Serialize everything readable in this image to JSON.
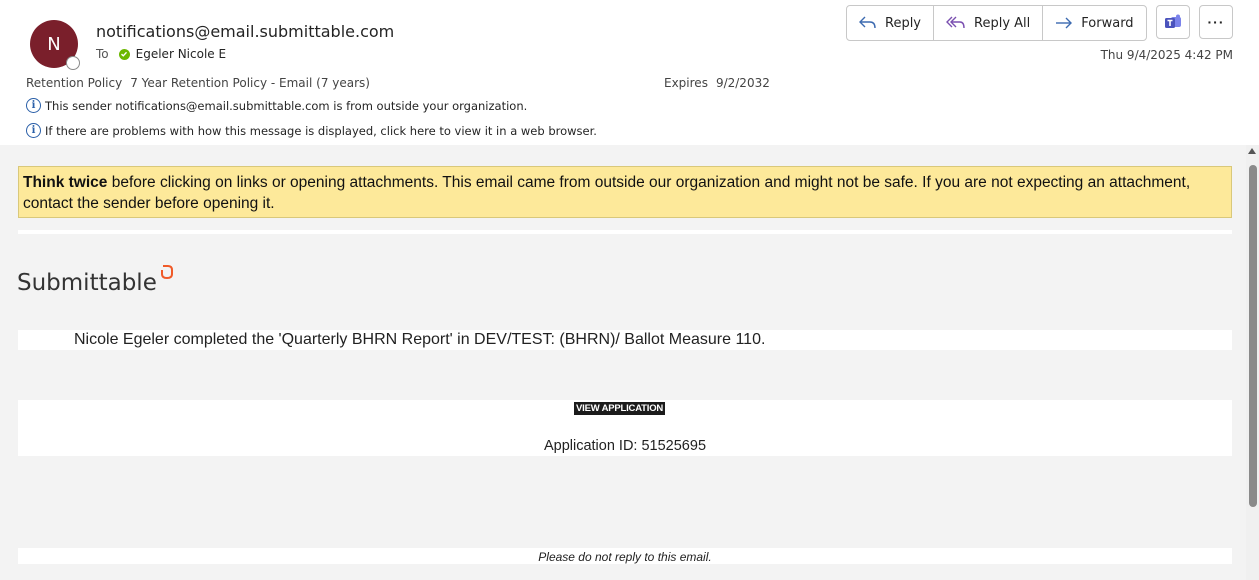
{
  "header": {
    "avatar_initial": "N",
    "sender": "notifications@email.submittable.com",
    "to_label": "To",
    "recipient": "Egeler Nicole E",
    "retention_label": "Retention Policy",
    "retention_value": "7 Year Retention Policy - Email (7 years)",
    "expires_label": "Expires",
    "expires_value": "9/2/2032",
    "info_external": "This sender notifications@email.submittable.com is from outside your organization.",
    "info_display": "If there are problems with how this message is displayed, click here to view it in a web browser.",
    "datetime": "Thu 9/4/2025 4:42 PM"
  },
  "actions": {
    "reply": "Reply",
    "reply_all": "Reply All",
    "forward": "Forward",
    "more": "···"
  },
  "body": {
    "warning_bold": "Think twice",
    "warning_text": " before clicking on links or opening attachments. This email came from outside our organization and might not be safe. If you are not expecting an attachment, contact the sender before opening it.",
    "brand": "Submittable",
    "message": "Nicole Egeler completed the 'Quarterly BHRN Report' in DEV/TEST: (BHRN)/ Ballot Measure 110.",
    "view_application": "VIEW APPLICATION",
    "application_id": "Application ID: 51525695",
    "footer": "Please do not reply to this email."
  },
  "colors": {
    "avatar": "#7a1f2b",
    "warning_bg": "#fde99a",
    "info_icon": "#2a5fa8",
    "presence": "#6bb700",
    "brand_logo": "#f05a28"
  },
  "icons": [
    "reply-icon",
    "reply-all-icon",
    "forward-icon",
    "teams-icon",
    "more-icon",
    "info-icon",
    "presence-available-icon",
    "submittable-logo-icon"
  ]
}
